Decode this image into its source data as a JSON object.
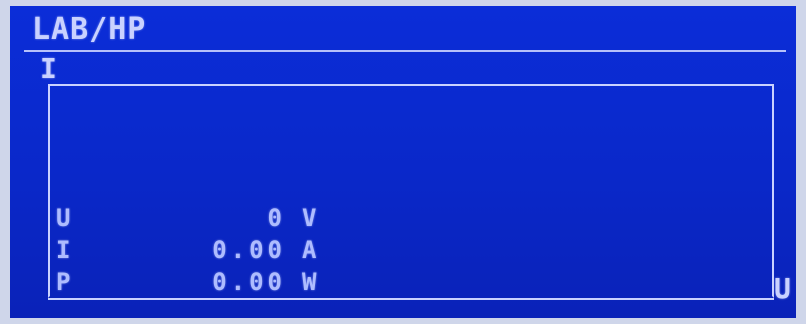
{
  "screen": {
    "title": "LAB/HP",
    "y_axis_label": "I",
    "x_axis_label": "U"
  },
  "readouts": [
    {
      "label": "U",
      "value": "0",
      "unit": "V"
    },
    {
      "label": "I",
      "value": "0.00",
      "unit": "A"
    },
    {
      "label": "P",
      "value": "0.00",
      "unit": "W"
    }
  ],
  "colors": {
    "background": "#0a28c9",
    "foreground": "#c9d2ff",
    "bezel": "#cfd6ea"
  }
}
